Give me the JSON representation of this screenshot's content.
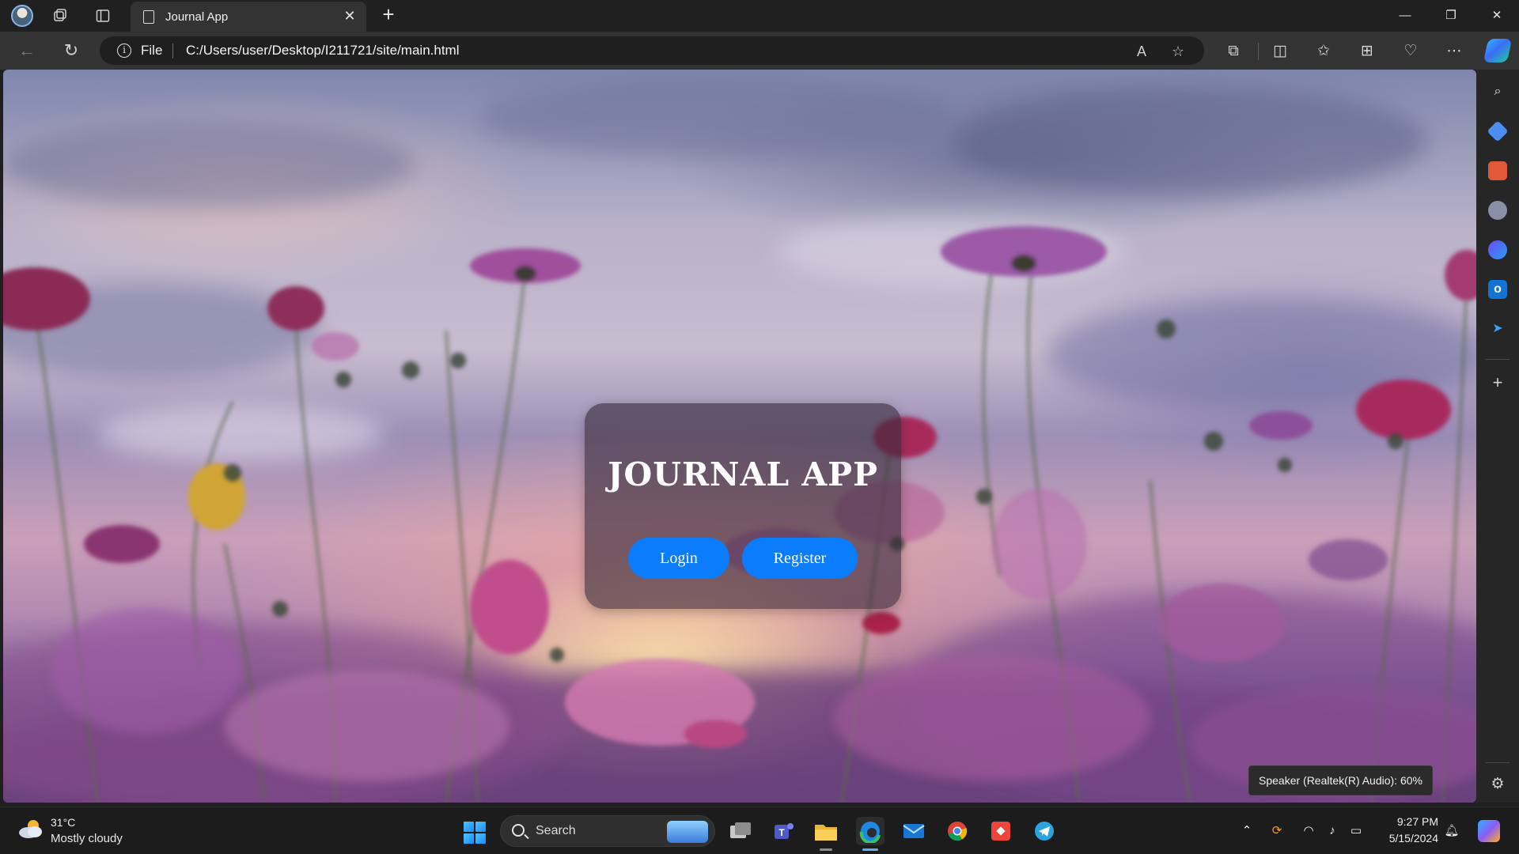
{
  "browser": {
    "tab": {
      "title": "Journal App"
    },
    "address": {
      "scheme_label": "File",
      "url": "C:/Users/user/Desktop/I211721/site/main.html"
    },
    "window_controls": {
      "minimize": "—",
      "restore": "❐",
      "close": "✕"
    }
  },
  "page": {
    "title": "JOURNAL APP",
    "buttons": {
      "login": "Login",
      "register": "Register"
    },
    "accent_color": "#0b7dfc"
  },
  "tooltip": {
    "text": "Speaker (Realtek(R) Audio): 60%"
  },
  "taskbar": {
    "weather": {
      "temperature": "31°C",
      "condition": "Mostly cloudy"
    },
    "search": {
      "label": "Search"
    },
    "clock": {
      "time": "9:27 PM",
      "date": "5/15/2024"
    },
    "apps": [
      "widgets-icon",
      "file-explorer-icon",
      "teams-icon",
      "folder-icon",
      "edge-icon",
      "mail-icon",
      "chrome-icon",
      "anydesk-icon",
      "telegram-icon"
    ]
  }
}
